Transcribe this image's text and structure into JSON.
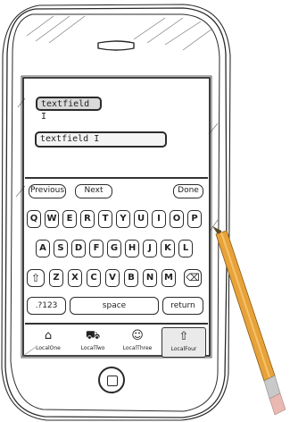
{
  "screen": {
    "fields": [
      {
        "value": "textfield I"
      },
      {
        "value": "textfield I"
      }
    ],
    "toolbar": {
      "previous": "Previous",
      "next": "Next",
      "done": "Done"
    },
    "keyboard": {
      "row1": [
        "Q",
        "W",
        "E",
        "R",
        "T",
        "Y",
        "U",
        "I",
        "O",
        "P"
      ],
      "row2": [
        "A",
        "S",
        "D",
        "F",
        "G",
        "H",
        "J",
        "K",
        "L"
      ],
      "row3": [
        "Z",
        "X",
        "C",
        "V",
        "B",
        "N",
        "M"
      ],
      "shift_icon": "shift-arrow-icon",
      "backspace_icon": "backspace-icon",
      "numbers": ".?123",
      "space": "space",
      "return": "return"
    },
    "tabbar": [
      {
        "label": "LocalOne",
        "icon": "house-icon",
        "glyph": "⌂"
      },
      {
        "label": "LocalTwo",
        "icon": "pickup-truck-icon",
        "glyph": "⛟"
      },
      {
        "label": "LocalThree",
        "icon": "person-icon",
        "glyph": "☺"
      },
      {
        "label": "LocalFour",
        "icon": "up-arrow-icon",
        "glyph": "⇧"
      }
    ]
  }
}
